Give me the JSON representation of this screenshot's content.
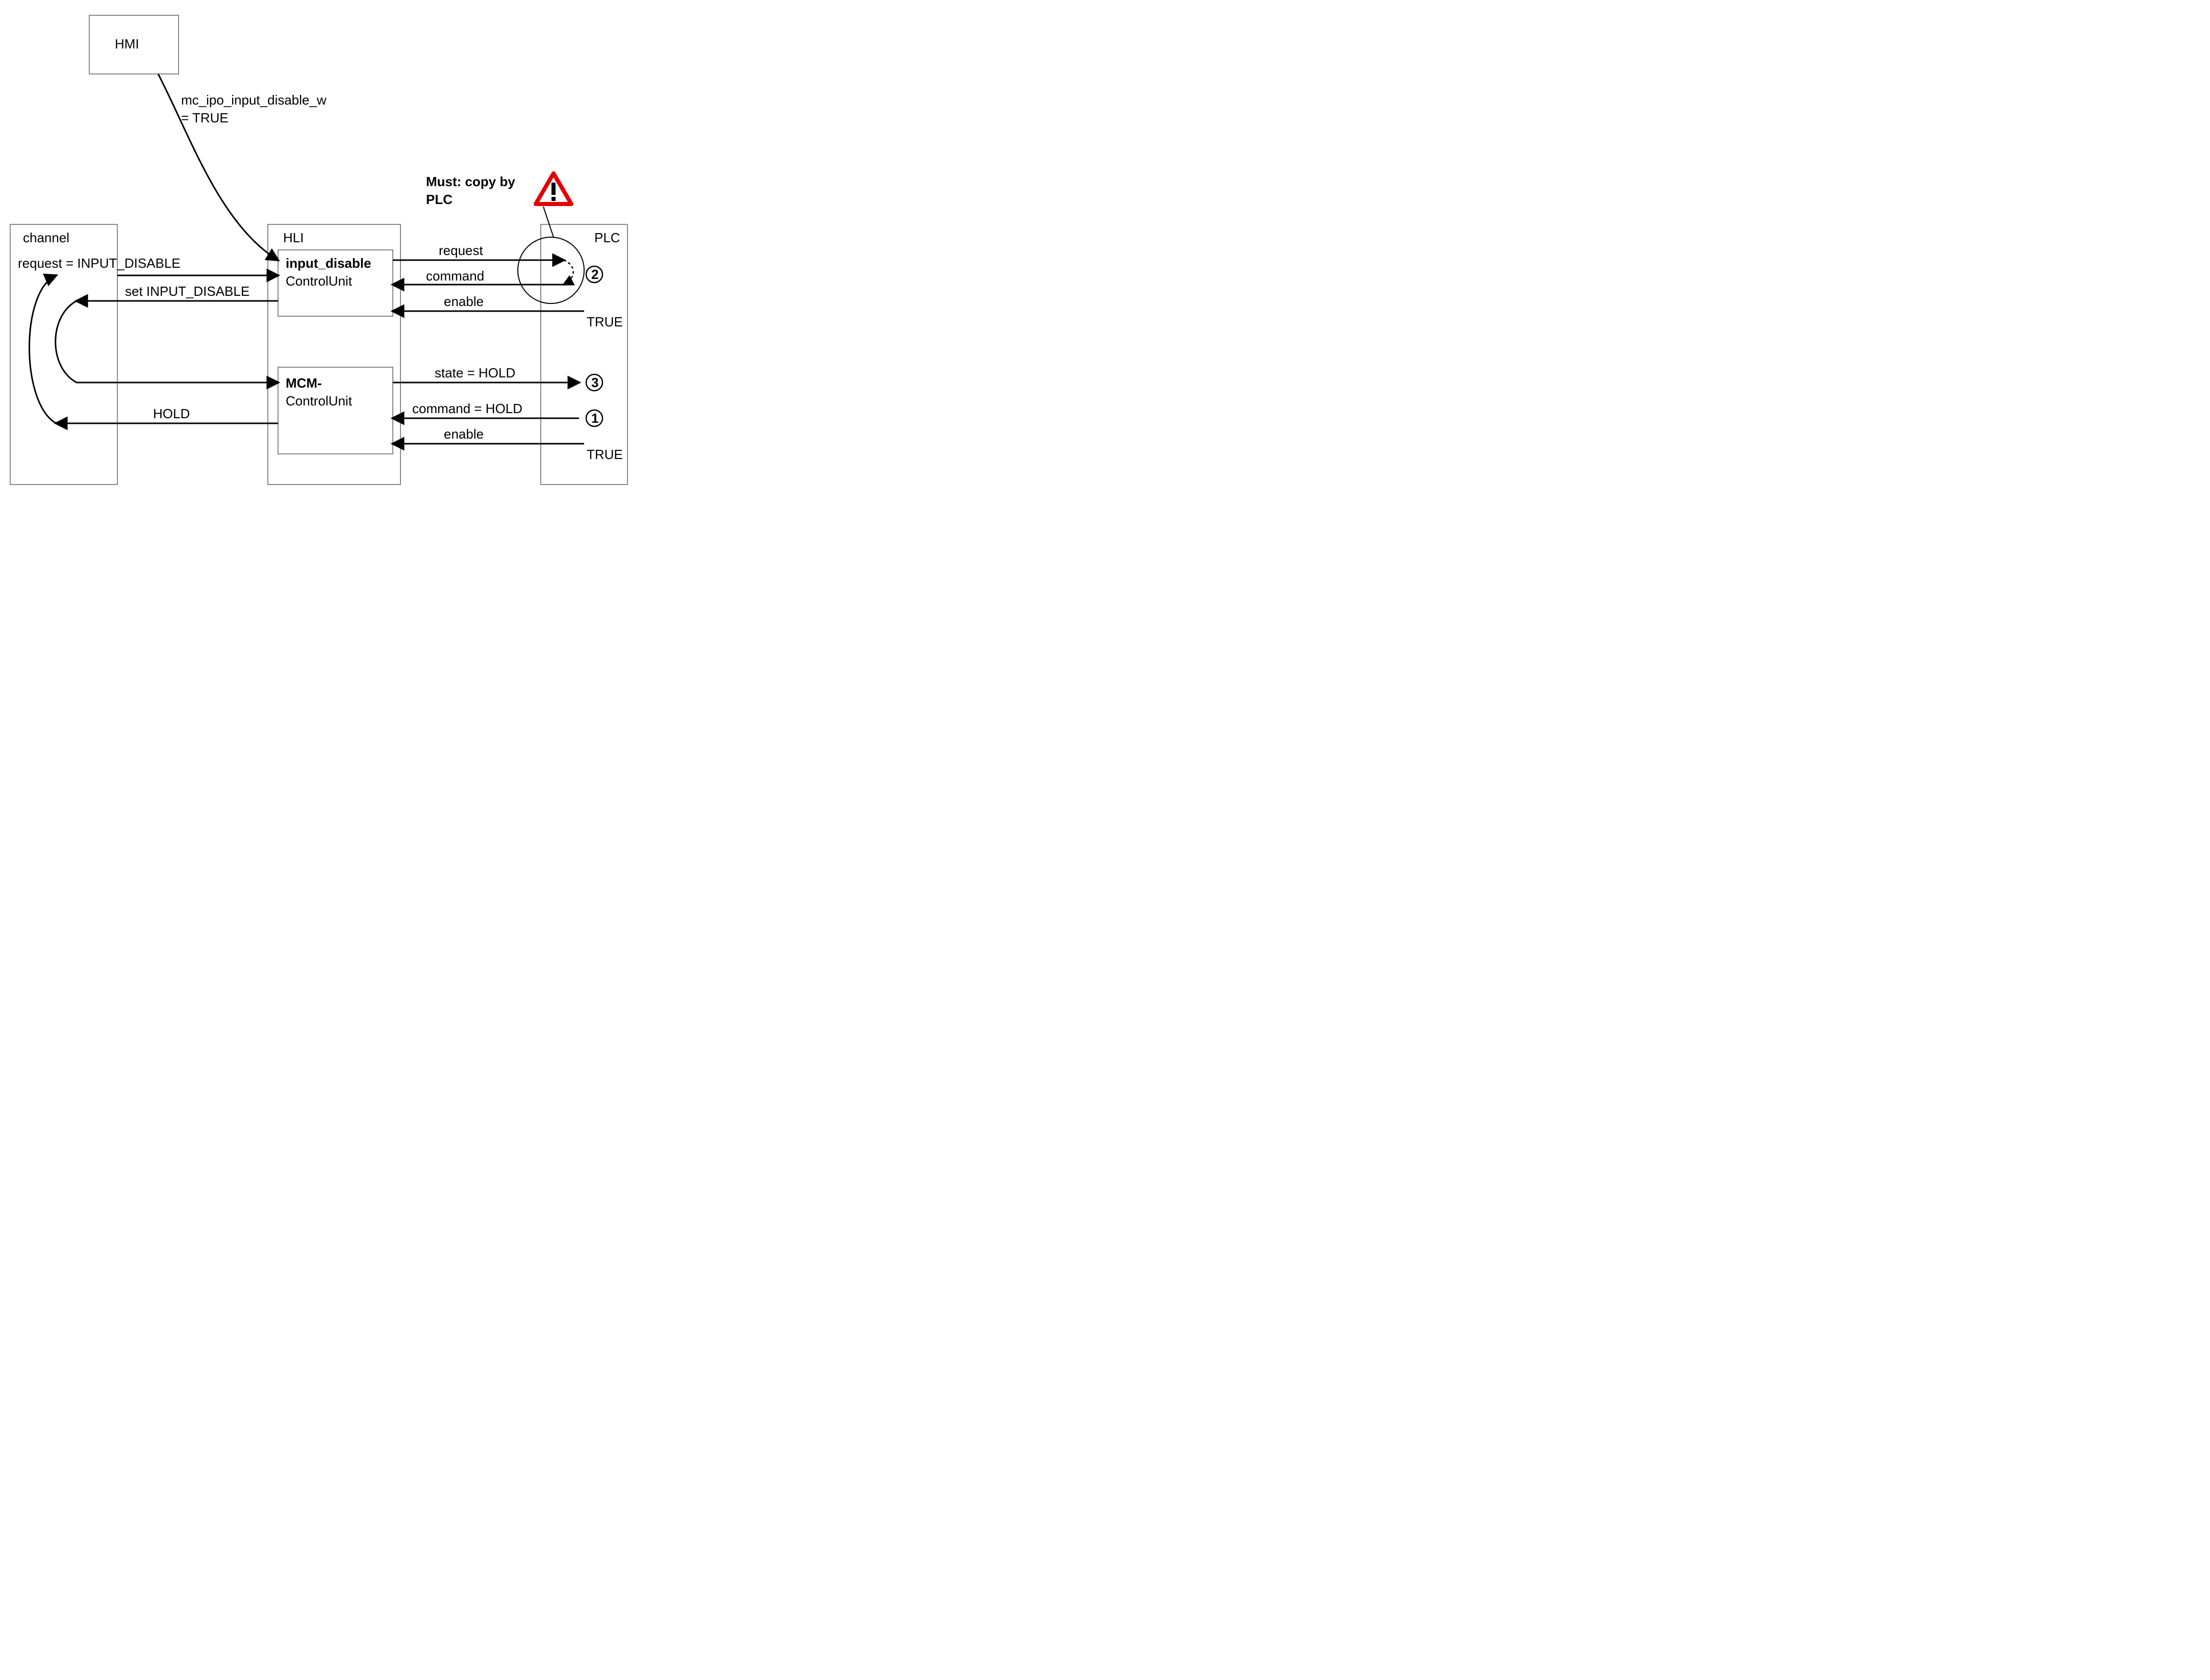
{
  "hmi": {
    "label": "HMI",
    "note1": "mc_ipo_input_disable_w",
    "note2": "= TRUE"
  },
  "channel": {
    "label": "channel",
    "request": "request = INPUT_DISABLE",
    "setInput": "set INPUT_DISABLE",
    "hold": "HOLD"
  },
  "hli": {
    "label": "HLI",
    "cu1": {
      "title": "input_disable",
      "subtitle": "ControlUnit"
    },
    "cu2": {
      "title": "MCM-",
      "subtitle": "ControlUnit"
    }
  },
  "plc": {
    "label": "PLC",
    "must1": "Must: copy by",
    "must2": "PLC",
    "request": "request",
    "command": "command",
    "enable": "enable",
    "state": "state = HOLD",
    "cmdHold": "command = HOLD",
    "trueTxt": "TRUE"
  },
  "marks": {
    "m1": "1",
    "m2": "2",
    "m3": "3"
  }
}
